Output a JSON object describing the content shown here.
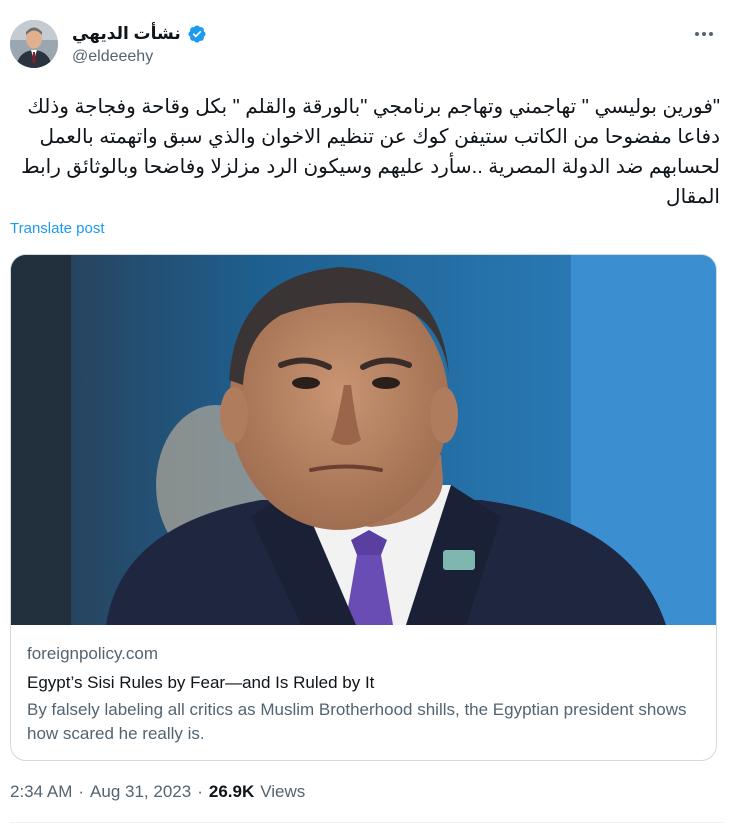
{
  "author": {
    "display_name": "نشأت الديهي",
    "handle": "@eldeeehy",
    "verified": true,
    "avatar_icon": "user-avatar"
  },
  "more_icon": "more-horizontal-icon",
  "tweet": {
    "text": "\"فورين بوليسي \" تهاجمني وتهاجم برنامجي \"بالورقة والقلم \" بكل وقاحة وفجاجة وذلك دفاعا مفضوحا من الكاتب ستيفن كوك عن تنظيم الاخوان والذي سبق واتهمته بالعمل لحسابهم ضد الدولة المصرية ..سأرد عليهم وسيكون الرد مزلزلا وفاضحا وبالوثائق رابط المقال",
    "translate_label": "Translate post"
  },
  "link_card": {
    "domain": "foreignpolicy.com",
    "title": "Egypt’s Sisi Rules by Fear—and Is Ruled by It",
    "description": "By falsely labeling all critics as Muslim Brotherhood shills, the Egyptian president shows how scared he really is."
  },
  "meta": {
    "time": "2:34 AM",
    "separator": "·",
    "date": "Aug 31, 2023",
    "views_count": "26.9K",
    "views_label": "Views"
  },
  "colors": {
    "accent": "#1d9bf0",
    "text_primary": "#0f1419",
    "text_secondary": "#536471",
    "border": "#cfd9de"
  }
}
